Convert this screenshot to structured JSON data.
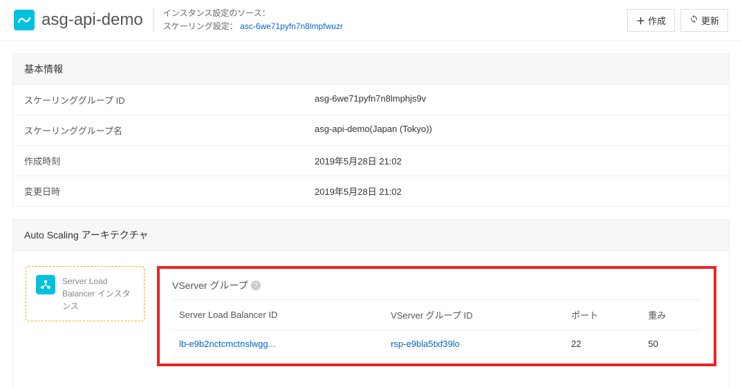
{
  "header": {
    "title": "asg-api-demo",
    "meta_source_label": "インスタンス設定のソース：",
    "meta_scaling_label": "スケーリング設定：",
    "meta_scaling_link": "asc-6we71pyfn7n8lmpfwuzr",
    "create_label": "作成",
    "refresh_label": "更新"
  },
  "basic_info": {
    "section_title": "基本情報",
    "rows": [
      {
        "label": "スケーリンググループ ID",
        "value": "asg-6we71pyfn7n8lmphjs9v"
      },
      {
        "label": "スケーリンググループ名",
        "value": "asg-api-demo(Japan (Tokyo))"
      },
      {
        "label": "作成時刻",
        "value": "2019年5月28日 21:02"
      },
      {
        "label": "変更日時",
        "value": "2019年5月28日 21:02"
      }
    ]
  },
  "architecture": {
    "section_title": "Auto Scaling アーキテクチャ",
    "slb_card_label": "Server Load Balancer インスタンス",
    "vserver_title": "VServer グループ",
    "table": {
      "headers": [
        "Server Load Balancer ID",
        "VServer グループ ID",
        "ポート",
        "重み"
      ],
      "row": {
        "slb_id": "lb-e9b2nctcmctnslwgg...",
        "vserver_id": "rsp-e9bla5txf39lo",
        "port": "22",
        "weight": "50"
      }
    }
  }
}
